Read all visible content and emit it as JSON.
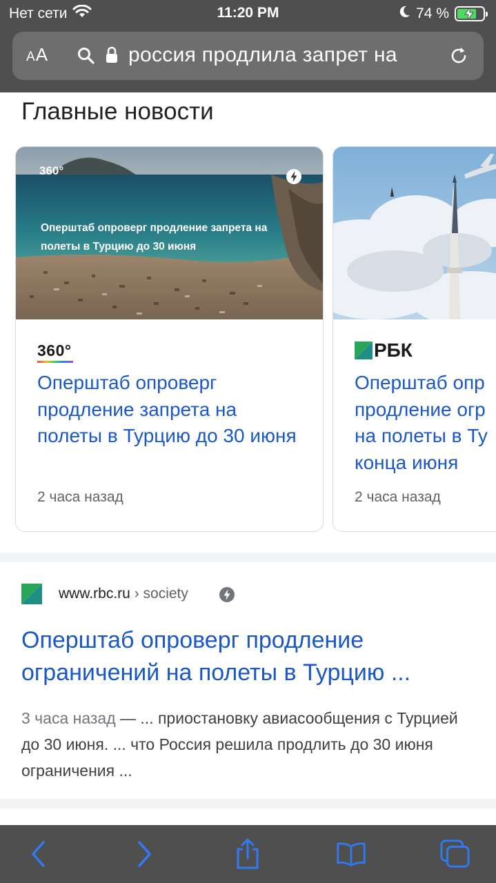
{
  "status_bar": {
    "carrier": "Нет сети",
    "time": "11:20 PM",
    "battery_percent": "74 %",
    "battery_level": 0.74
  },
  "address_bar": {
    "text_size_label": "AA",
    "url_text": "россия продлила запрет на"
  },
  "top_stories": {
    "title": "Главные новости",
    "cards": [
      {
        "source": "360°",
        "image_overlay_text": "Оперштаб опроверг продление запрета на полеты в Турцию до 30 июня",
        "image_logo": "360°",
        "headline": "Оперштаб опроверг продление запрета на полеты в Турцию до 30 июня",
        "time": "2 часа назад"
      },
      {
        "source": "РБК",
        "headline": "Оперштаб опр... продление огр... на полеты в Ту... конца июня",
        "time": "2 часа назад"
      }
    ]
  },
  "result": {
    "domain": "www.rbc.ru",
    "path": " › society",
    "title": "Оперштаб опроверг продление ограничений на полеты в Турцию ...",
    "date": "3 часа назад",
    "snippet": " — ... приостановку авиасообщения с Турцией до 30 июня. ... что Россия решила продлить до 30 июня ограничения ..."
  },
  "colors": {
    "chrome": "#4f4f4f",
    "link": "#1a57c7",
    "ios_blue": "#2f7bf5",
    "battery_green": "#4cd964"
  }
}
